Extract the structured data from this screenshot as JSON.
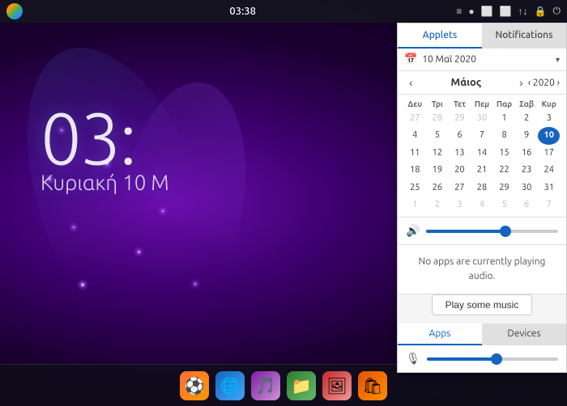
{
  "taskbar": {
    "time": "03:38",
    "icons": [
      "≡",
      "●",
      "⬛",
      "⬛",
      "↑",
      "🔒",
      "⏻"
    ]
  },
  "desktop": {
    "time": "03:",
    "date": "Κυριακή 10 Μ"
  },
  "panel": {
    "tab_applets": "Applets",
    "tab_notifications": "Notifications",
    "calendar_date": "10 Μαϊ 2020",
    "month_prev": "‹",
    "month_name": "Μάιος",
    "month_next": "›",
    "year": "‹ 2020 ›",
    "days_header": [
      "Δευ",
      "Τρι",
      "Τετ",
      "Πεμ",
      "Παρ",
      "Σαβ",
      "Κυρ"
    ],
    "weeks": [
      [
        "27",
        "28",
        "29",
        "30",
        "1",
        "2",
        "3"
      ],
      [
        "4",
        "5",
        "6",
        "7",
        "8",
        "9",
        "10"
      ],
      [
        "11",
        "12",
        "13",
        "14",
        "15",
        "16",
        "17"
      ],
      [
        "18",
        "19",
        "20",
        "21",
        "22",
        "23",
        "24"
      ],
      [
        "25",
        "26",
        "27",
        "28",
        "29",
        "30",
        "31"
      ],
      [
        "1",
        "2",
        "3",
        "4",
        "5",
        "6",
        "7"
      ]
    ],
    "week_classes": [
      [
        "other-month",
        "other-month",
        "other-month",
        "other-month",
        "",
        "",
        ""
      ],
      [
        "",
        "",
        "",
        "",
        "",
        "",
        "today"
      ],
      [
        "",
        "",
        "",
        "",
        "",
        "",
        ""
      ],
      [
        "",
        "",
        "",
        "",
        "",
        "",
        ""
      ],
      [
        "",
        "",
        "",
        "",
        "",
        "",
        ""
      ],
      [
        "other-month",
        "other-month",
        "other-month",
        "other-month",
        "other-month",
        "other-month",
        "other-month"
      ]
    ],
    "audio_message": "No apps are currently playing audio.",
    "play_music_label": "Play some music",
    "bottom_tab_apps": "Apps",
    "bottom_tab_devices": "Devices"
  },
  "dock": {
    "icons": [
      {
        "name": "soccer",
        "emoji": "⚽"
      },
      {
        "name": "browser",
        "emoji": "🌐"
      },
      {
        "name": "music",
        "emoji": "🎵"
      },
      {
        "name": "files",
        "emoji": "📁"
      },
      {
        "name": "photos",
        "emoji": "🖼"
      },
      {
        "name": "store",
        "emoji": "🛍"
      }
    ]
  }
}
